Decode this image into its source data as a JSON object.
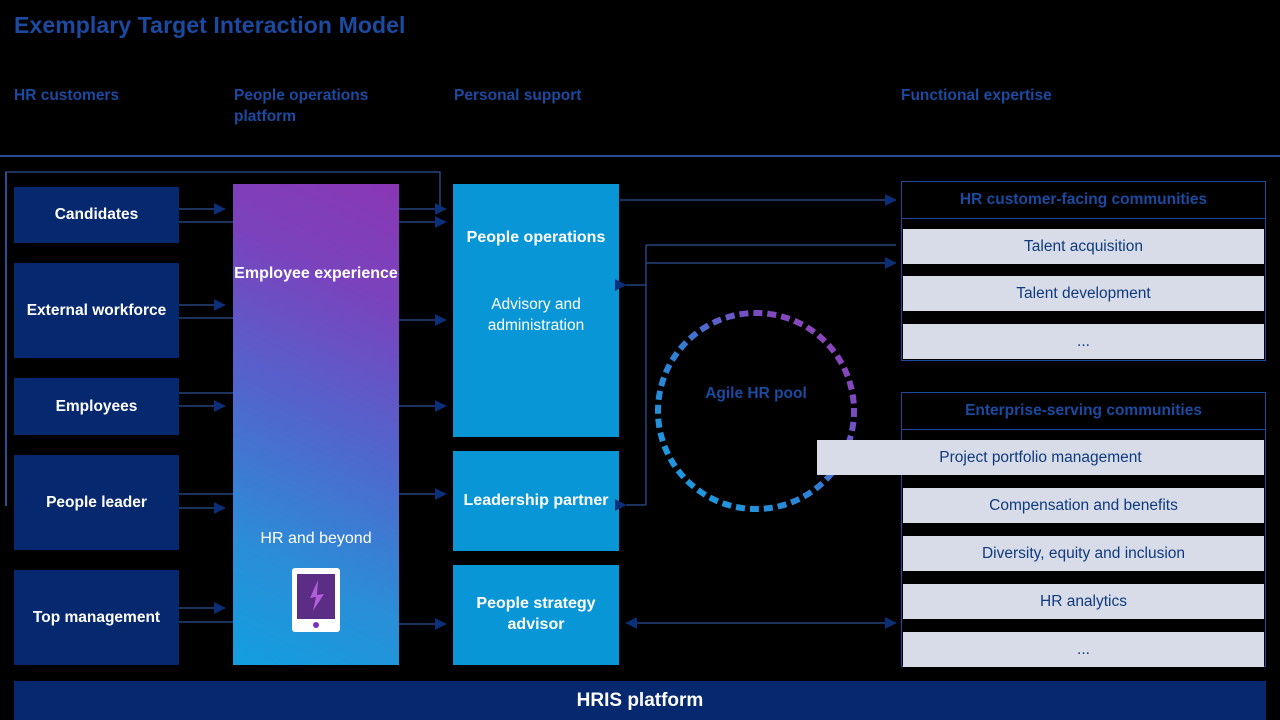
{
  "page": {
    "title": "Exemplary Target Interaction Model",
    "accent_navy": "#1b4aa0",
    "box_navy": "#06286e",
    "cyan": "#0896d7",
    "item_grey": "#d7dce8",
    "background": "#000000"
  },
  "columns": [
    {
      "label": "HR customers"
    },
    {
      "label": "People operations platform"
    },
    {
      "label": "Personal support"
    },
    {
      "label": "Functional expertise"
    }
  ],
  "hr_customers": [
    {
      "label": "Candidates"
    },
    {
      "label": "External workforce"
    },
    {
      "label": "Employees"
    },
    {
      "label": "People leader"
    },
    {
      "label": "Top management"
    }
  ],
  "platform": {
    "title": "Employee experience",
    "subtitle": "HR and beyond",
    "icon": "tablet-lightning-icon"
  },
  "personal_support": [
    {
      "title": "People operations",
      "subtitle": "Advisory and administration"
    },
    {
      "title": "Leadership partner",
      "subtitle": ""
    },
    {
      "title": "People strategy advisor",
      "subtitle": ""
    }
  ],
  "agile_pool": {
    "label": "Agile HR pool",
    "shape": "dotted-circle"
  },
  "functional_expertise": [
    {
      "header": "HR customer-facing communities",
      "items": [
        "Talent acquisition",
        "Talent development",
        "..."
      ]
    },
    {
      "header": "Enterprise-serving communities",
      "items": [
        "Project portfolio management",
        "Compensation and benefits",
        "Diversity, equity and inclusion",
        "HR analytics",
        "..."
      ]
    }
  ],
  "footer": {
    "label": "HRIS platform"
  }
}
